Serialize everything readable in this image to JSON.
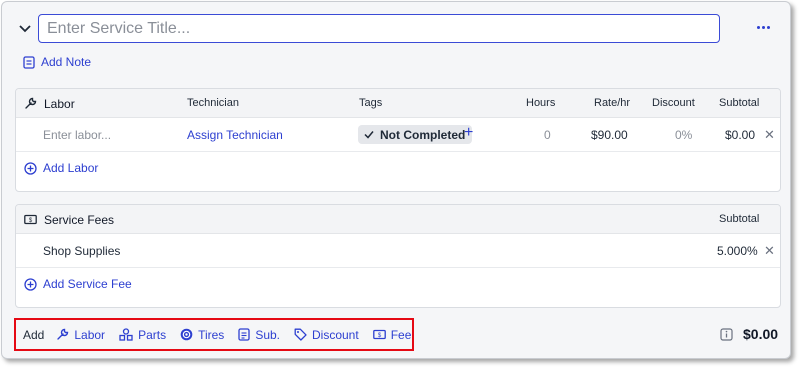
{
  "service": {
    "title_placeholder": "Enter Service Title...",
    "title_value": "",
    "add_note_label": "Add Note",
    "total": "$0.00"
  },
  "labor": {
    "header": {
      "title": "Labor",
      "technician": "Technician",
      "tags": "Tags",
      "hours": "Hours",
      "rate": "Rate/hr",
      "discount": "Discount",
      "subtotal": "Subtotal"
    },
    "rows": [
      {
        "labor_placeholder": "Enter labor...",
        "technician": "Assign Technician",
        "tag": "Not Completed",
        "hours": "0",
        "rate": "$90.00",
        "discount": "0%",
        "subtotal": "$0.00"
      }
    ],
    "add_label": "Add Labor"
  },
  "service_fees": {
    "header": {
      "title": "Service Fees",
      "subtotal": "Subtotal"
    },
    "rows": [
      {
        "name": "Shop Supplies",
        "value": "5.000%"
      }
    ],
    "add_label": "Add Service Fee"
  },
  "add_bar": {
    "label": "Add",
    "items": [
      {
        "label": "Labor",
        "icon": "wrench-icon"
      },
      {
        "label": "Parts",
        "icon": "parts-icon"
      },
      {
        "label": "Tires",
        "icon": "tire-icon"
      },
      {
        "label": "Sub.",
        "icon": "sublet-icon"
      },
      {
        "label": "Discount",
        "icon": "tag-icon"
      },
      {
        "label": "Fee",
        "icon": "fee-icon"
      }
    ]
  },
  "colors": {
    "accent": "#2d3fd0",
    "highlight_border": "#e50914"
  }
}
